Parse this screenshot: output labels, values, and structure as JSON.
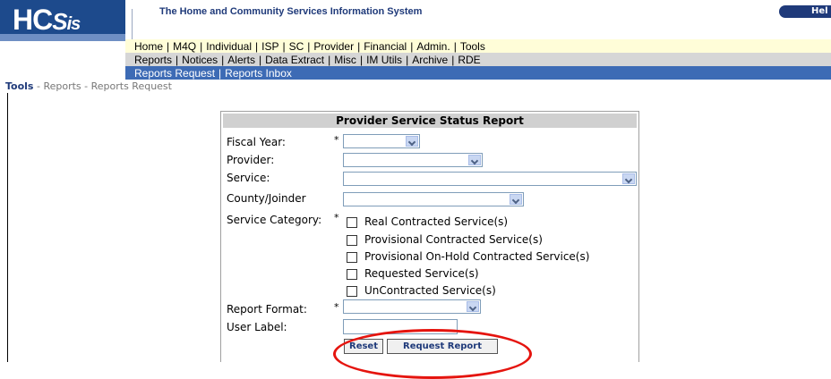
{
  "header": {
    "logo_text": "HC",
    "logo_sub": "Sis",
    "system_title": "The Home and Community Services Information System",
    "help_label": "Hel"
  },
  "nav": {
    "main": [
      "Home",
      "M4Q",
      "Individual",
      "ISP",
      "SC",
      "Provider",
      "Financial",
      "Admin.",
      "Tools"
    ],
    "sub": [
      "Reports",
      "Notices",
      "Alerts",
      "Data Extract",
      "Misc",
      "IM Utils",
      "Archive",
      "RDE"
    ],
    "tools": [
      "Reports Request",
      "Reports Inbox"
    ]
  },
  "breadcrumb": {
    "root": "Tools",
    "rest": " - Reports - Reports Request"
  },
  "form": {
    "title": "Provider Service Status Report",
    "fiscal_year_label": "Fiscal Year:",
    "provider_label": "Provider:",
    "service_label": "Service:",
    "county_label": "County/Joinder",
    "category_label": "Service Category:",
    "required_mark": "*",
    "categories": [
      "Real Contracted Service(s)",
      "Provisional Contracted Service(s)",
      "Provisional On-Hold Contracted Service(s)",
      "Requested Service(s)",
      "UnContracted Service(s)"
    ],
    "report_format_label": "Report Format:",
    "user_label_label": "User Label:",
    "reset_button": "Reset",
    "request_button": "Request Report"
  },
  "colors": {
    "annotation": "#e5140e",
    "header_blue": "#1d4a8c",
    "nav_tools_blue": "#3d6bb5"
  }
}
